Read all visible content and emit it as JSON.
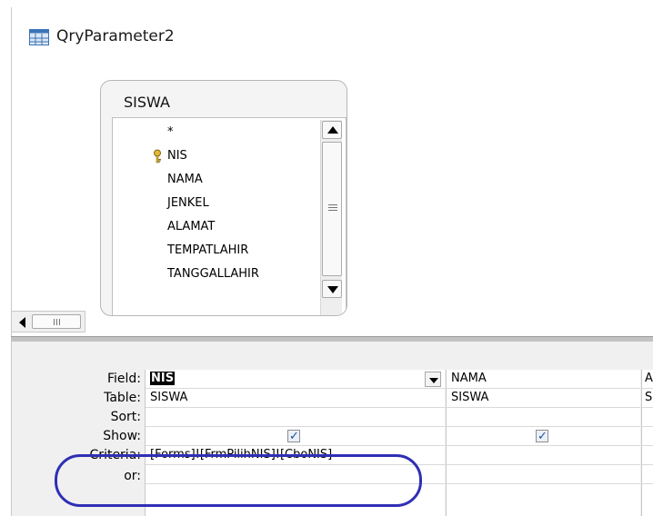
{
  "window": {
    "title": "QryParameter2",
    "icon": "query-icon"
  },
  "table_box": {
    "name": "SISWA",
    "fields": [
      "*",
      "NIS",
      "NAMA",
      "JENKEL",
      "ALAMAT",
      "TEMPATLAHIR",
      "TANGGALLAHIR"
    ],
    "primary_key_field": "NIS"
  },
  "grid": {
    "row_labels": {
      "field": "Field:",
      "table": "Table:",
      "sort": "Sort:",
      "show": "Show:",
      "criteria": "Criteria:",
      "or": "or:"
    },
    "columns": [
      {
        "field": "NIS",
        "table": "SISWA",
        "sort": "",
        "show": true,
        "criteria": "[Forms]![FrmPilihNIS]![CboNIS]",
        "or": ""
      },
      {
        "field": "NAMA",
        "table": "SISWA",
        "sort": "",
        "show": true,
        "criteria": "",
        "or": ""
      },
      {
        "field": "A",
        "table": "S",
        "sort": "",
        "show": false,
        "criteria": "",
        "or": ""
      }
    ]
  },
  "colors": {
    "highlight": "#2f2fb5"
  }
}
